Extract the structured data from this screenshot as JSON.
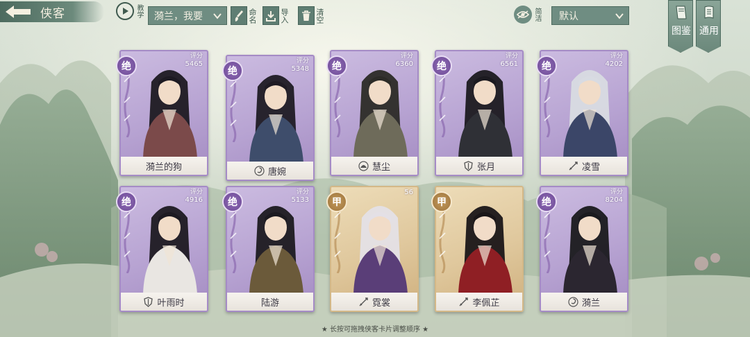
{
  "header": {
    "title": "侠客",
    "teach_label": "教学",
    "preset_value": "漪兰，我要",
    "sign_label": "命名",
    "import_label": "导入",
    "clear_label": "清空",
    "filter_label": "简洁",
    "sort_value": "默认"
  },
  "side_tabs": {
    "atlas_label": "图鉴",
    "general_label": "通用"
  },
  "cards": [
    {
      "name": "漪兰的狗",
      "grade": "绝",
      "score_label": "评分",
      "score": "5465",
      "theme": "purple"
    },
    {
      "name": "唐婉",
      "grade": "绝",
      "score_label": "评分",
      "score": "5348",
      "theme": "purple"
    },
    {
      "name": "慧尘",
      "grade": "绝",
      "score_label": "评分",
      "score": "6360",
      "theme": "purple"
    },
    {
      "name": "张月",
      "grade": "绝",
      "score_label": "评分",
      "score": "6561",
      "theme": "purple"
    },
    {
      "name": "凌雪",
      "grade": "绝",
      "score_label": "评分",
      "score": "4202",
      "theme": "purple"
    },
    {
      "name": "叶雨时",
      "grade": "绝",
      "score_label": "评分",
      "score": "4916",
      "theme": "purple"
    },
    {
      "name": "陆游",
      "grade": "绝",
      "score_label": "评分",
      "score": "5133",
      "theme": "purple"
    },
    {
      "name": "霓裳",
      "grade": "甲",
      "score_label": "",
      "score": "56",
      "theme": "gold"
    },
    {
      "name": "李佩芷",
      "grade": "甲",
      "score_label": "",
      "score": "",
      "theme": "gold"
    },
    {
      "name": "漪兰",
      "grade": "绝",
      "score_label": "评分",
      "score": "8204",
      "theme": "purple"
    }
  ],
  "footer": {
    "hint": "★ 长按可拖拽侠客卡片调整顺序 ★"
  },
  "colors": {
    "accent": "#6f8d82",
    "card_purple": "#b7a3d2",
    "card_gold": "#dfc79c"
  }
}
